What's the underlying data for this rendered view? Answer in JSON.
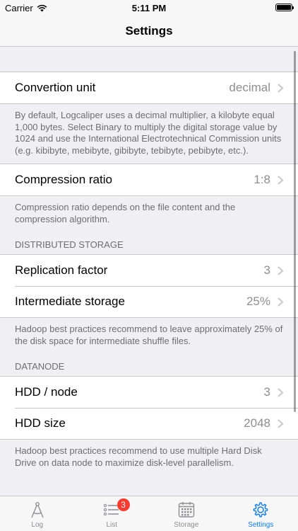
{
  "status_bar": {
    "carrier": "Carrier",
    "time": "5:11 PM"
  },
  "nav": {
    "title": "Settings"
  },
  "sections": {
    "conversion": {
      "label": "Convertion unit",
      "value": "decimal",
      "footer": "By default, Logcaliper uses a decimal multiplier, a kilobyte equal 1,000 bytes. Select Binary to multiply the digital storage value by 1024 and use the International Electrotechnical Commission units (e.g. kibibyte, mebibyte, gibibyte, tebibyte, pebibyte, etc.)."
    },
    "compression": {
      "label": "Compression ratio",
      "value": "1:8",
      "footer": "Compression ratio depends on the file content and the compression algorithm."
    },
    "distributed": {
      "header": "DISTRIBUTED STORAGE",
      "replication_label": "Replication factor",
      "replication_value": "3",
      "intermediate_label": "Intermediate storage",
      "intermediate_value": "25%",
      "footer": "Hadoop best practices recommend to leave approximately 25% of the disk space for intermediate shuffle files."
    },
    "datanode": {
      "header": "DATANODE",
      "hdd_node_label": "HDD / node",
      "hdd_node_value": "3",
      "hdd_size_label": "HDD size",
      "hdd_size_value": "2048",
      "footer": "Hadoop best practices recommend to use multiple Hard Disk Drive on data node to maximize disk-level parallelism."
    }
  },
  "tabs": {
    "log": "Log",
    "list": "List",
    "list_badge": "3",
    "storage": "Storage",
    "settings": "Settings"
  },
  "colors": {
    "accent": "#0a7bff",
    "badge": "#ff3b30",
    "background": "#efeff4"
  },
  "icons": {
    "log": "compass-icon",
    "list": "list-icon",
    "storage": "calendar-grid-icon",
    "settings": "gear-icon",
    "row": "chevron-right-icon"
  }
}
